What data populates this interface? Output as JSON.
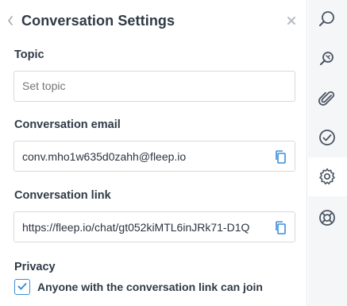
{
  "header": {
    "title": "Conversation Settings"
  },
  "topic": {
    "label": "Topic",
    "placeholder": "Set topic",
    "value": ""
  },
  "email": {
    "label": "Conversation email",
    "value": "conv.mho1w635d0zahh@fleep.io"
  },
  "link": {
    "label": "Conversation link",
    "value": "https://fleep.io/chat/gt052kiMTL6inJRk71-D1Q"
  },
  "privacy": {
    "label": "Privacy",
    "checkbox_label": "Anyone with the conversation link can join",
    "checked": true
  },
  "rail": {
    "items": [
      {
        "icon": "search-icon"
      },
      {
        "icon": "pin-search-icon"
      },
      {
        "icon": "attachment-icon"
      },
      {
        "icon": "task-check-icon"
      },
      {
        "icon": "gear-icon",
        "active": true
      },
      {
        "icon": "help-lifebuoy-icon"
      }
    ]
  },
  "colors": {
    "accent": "#3a8ed8",
    "text": "#2f3a47",
    "rail_bg": "#f5f6f7",
    "border": "#d6dade"
  }
}
